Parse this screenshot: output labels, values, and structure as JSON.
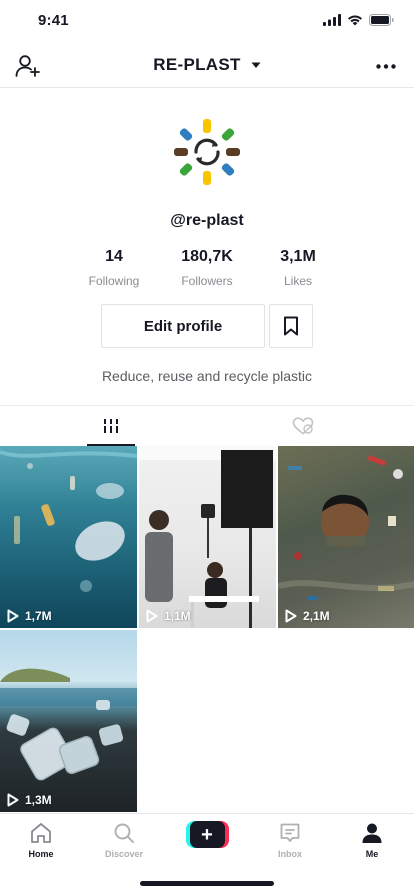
{
  "status_bar": {
    "time": "9:41"
  },
  "header": {
    "account_name": "RE-PLAST"
  },
  "profile": {
    "username": "@re-plast",
    "bio": "Reduce, reuse and recycle plastic",
    "stats": {
      "following": {
        "value": "14",
        "label": "Following"
      },
      "followers": {
        "value": "180,7K",
        "label": "Followers"
      },
      "likes": {
        "value": "3,1M",
        "label": "Likes"
      }
    },
    "edit_profile_label": "Edit profile"
  },
  "videos": [
    {
      "views": "1,7M",
      "subject": "plastic waste underwater"
    },
    {
      "views": "1,1M",
      "subject": "studio filming session"
    },
    {
      "views": "2,1M",
      "subject": "child swimming in polluted water"
    },
    {
      "views": "1,3M",
      "subject": "plastic cups on a beach"
    }
  ],
  "tabbar": {
    "home": "Home",
    "discover": "Discover",
    "inbox": "Inbox",
    "me": "Me",
    "create_symbol": "+"
  },
  "colors": {
    "text_primary": "#161823",
    "text_secondary": "#8a8b91",
    "border": "#e3e3e4",
    "accent_cyan": "#25f4ee",
    "accent_red": "#fe2c55"
  },
  "icons": {
    "add_friend": "person-plus-icon",
    "dropdown": "caret-down-icon",
    "more": "ellipsis-icon",
    "bookmark": "bookmark-icon",
    "videos_tab": "grid-bars-icon",
    "liked_tab": "heart-hidden-icon",
    "play": "play-icon",
    "home": "home-icon",
    "discover": "search-icon",
    "inbox": "inbox-icon",
    "me": "person-icon"
  }
}
